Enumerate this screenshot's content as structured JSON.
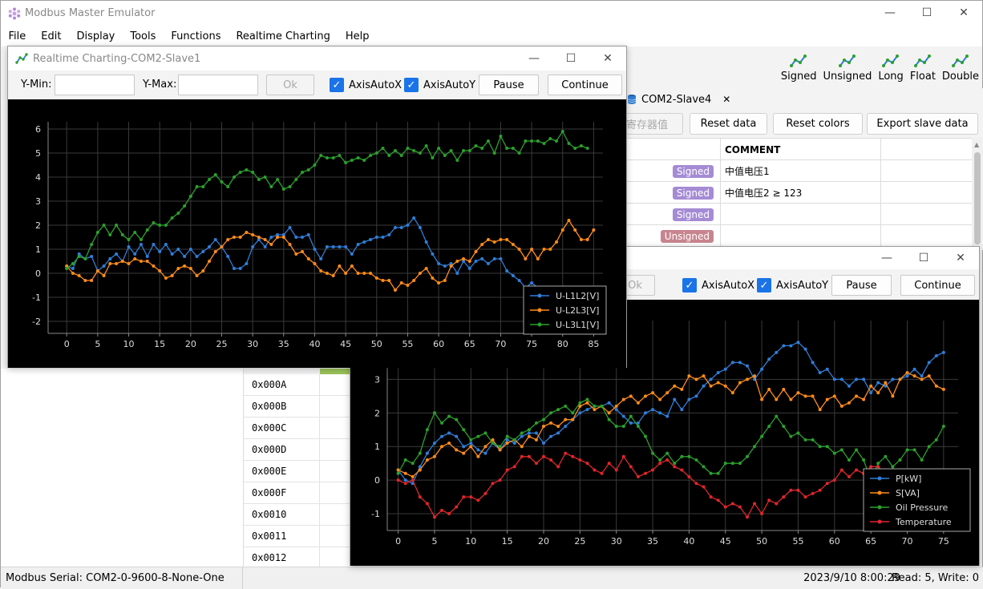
{
  "app": {
    "title": "Modbus Master Emulator",
    "menu": [
      "File",
      "Edit",
      "Display",
      "Tools",
      "Functions",
      "Realtime Charting",
      "Help"
    ],
    "win_buttons": {
      "minimize": "—",
      "maximize": "☐",
      "close": "✕"
    }
  },
  "typebar": {
    "items": [
      "Signed",
      "Unsigned",
      "Long",
      "Float",
      "Double"
    ]
  },
  "tab": {
    "label": "COM2-Slave4",
    "close": "✕"
  },
  "actions": {
    "read_registers": "寄存器值",
    "reset_data": "Reset data",
    "reset_colors": "Reset colors",
    "export": "Export slave data"
  },
  "grid": {
    "header": "COMMENT",
    "rows": [
      {
        "type": "Signed",
        "comment": "中值电压1"
      },
      {
        "type": "Signed",
        "comment": "中值电压2 ≥ 123"
      },
      {
        "type": "Signed",
        "comment": ""
      },
      {
        "type": "Unsigned",
        "comment": ""
      }
    ]
  },
  "addresses": [
    "0x000A",
    "0x000B",
    "0x000C",
    "0x000D",
    "0x000E",
    "0x000F",
    "0x0010",
    "0x0011",
    "0x0012"
  ],
  "status": {
    "left": "Modbus Serial: COM2-0-9600-8-None-One",
    "time": "2023/9/10 8:00:29",
    "counts": "Read: 5, Write: 0"
  },
  "colors": {
    "blue": "#2f7ed8",
    "orange": "#ff8c1a",
    "green": "#2ca02c",
    "red": "#e0262b",
    "badge_signed": "#a58bd4",
    "badge_unsigned": "#c8858f"
  },
  "chart1": {
    "title": "Realtime Charting-COM2-Slave1",
    "ymin_label": "Y-Min:",
    "ymax_label": "Y-Max:",
    "ok": "Ok",
    "auto_x": "AxisAutoX",
    "auto_y": "AxisAutoY",
    "pause": "Pause",
    "continue": "Continue"
  },
  "chart2": {
    "ok": "Ok",
    "auto_x": "AxisAutoX",
    "auto_y": "AxisAutoY",
    "pause": "Pause",
    "continue": "Continue"
  },
  "chart_data": [
    {
      "type": "line",
      "xlim": [
        0,
        86
      ],
      "ylim": [
        -2,
        6
      ],
      "x_ticks": [
        0,
        5,
        10,
        15,
        20,
        25,
        30,
        35,
        40,
        45,
        50,
        55,
        60,
        65,
        70,
        75,
        80,
        85
      ],
      "y_ticks": [
        -2,
        -1,
        0,
        1,
        2,
        3,
        4,
        5,
        6
      ],
      "grid": true,
      "legend": "bottom-right",
      "series": [
        {
          "name": "U-L1L2[V]",
          "color": "#2f7ed8",
          "values": [
            0.3,
            0.2,
            0.8,
            0.6,
            0.7,
            0.1,
            0.3,
            0.6,
            0.8,
            0.5,
            1.1,
            0.8,
            1.2,
            0.7,
            1.2,
            0.9,
            1.2,
            0.8,
            1.0,
            0.7,
            1.0,
            0.7,
            0.9,
            1.1,
            1.4,
            1.1,
            0.7,
            0.2,
            0.2,
            0.4,
            1.1,
            1.4,
            1.1,
            1.5,
            1.6,
            1.6,
            1.9,
            1.5,
            1.5,
            1.6,
            1.0,
            0.6,
            1.1,
            1.1,
            1.1,
            1.1,
            0.8,
            1.2,
            1.3,
            1.4,
            1.5,
            1.5,
            1.6,
            1.9,
            1.9,
            2.0,
            2.3,
            1.9,
            1.3,
            0.8,
            0.4,
            0.3,
            0.4,
            0.0,
            0.5,
            0.2,
            0.5,
            0.6,
            0.4,
            0.6,
            0.6,
            0.1,
            -0.1,
            -0.3,
            -0.6,
            -0.4,
            -0.6,
            -0.6
          ]
        },
        {
          "name": "U-L2L3[V]",
          "color": "#ff8c1a",
          "values": [
            0.3,
            0.0,
            -0.1,
            -0.3,
            -0.3,
            0.1,
            -0.1,
            0.4,
            0.4,
            0.5,
            0.4,
            0.6,
            0.5,
            0.5,
            0.3,
            0.1,
            -0.2,
            -0.1,
            0.2,
            0.3,
            0.2,
            -0.1,
            0.1,
            0.5,
            0.9,
            1.1,
            1.4,
            1.5,
            1.5,
            1.7,
            1.6,
            1.5,
            1.4,
            1.2,
            1.5,
            1.5,
            1.2,
            0.8,
            0.9,
            0.6,
            0.4,
            0.1,
            0.0,
            -0.1,
            0.3,
            0.0,
            0.3,
            0.0,
            0.0,
            0.0,
            -0.2,
            -0.3,
            -0.3,
            -0.7,
            -0.4,
            -0.5,
            -0.3,
            0.0,
            0.2,
            -0.2,
            -0.4,
            -0.3,
            0.3,
            0.5,
            0.6,
            0.5,
            0.9,
            1.2,
            1.4,
            1.3,
            1.4,
            1.4,
            1.2,
            1.0,
            0.6,
            1.0,
            0.6,
            1.0,
            1.0,
            1.3,
            1.8,
            2.2,
            1.8,
            1.4,
            1.4,
            1.8
          ]
        },
        {
          "name": "U-L3L1[V]",
          "color": "#2ca02c",
          "values": [
            0.2,
            0.4,
            0.7,
            0.6,
            1.2,
            1.7,
            2.0,
            1.6,
            2.0,
            1.6,
            1.4,
            1.7,
            1.4,
            1.8,
            2.1,
            2.0,
            2.0,
            2.3,
            2.5,
            2.8,
            3.2,
            3.6,
            3.6,
            3.9,
            4.1,
            3.8,
            3.6,
            4.0,
            4.2,
            4.3,
            4.2,
            3.9,
            4.0,
            3.6,
            3.9,
            3.5,
            3.6,
            3.9,
            4.2,
            4.3,
            4.5,
            4.9,
            4.8,
            4.8,
            4.9,
            4.6,
            4.7,
            4.8,
            4.7,
            4.9,
            5.0,
            5.2,
            4.9,
            5.1,
            4.9,
            5.2,
            5.1,
            5.0,
            5.3,
            4.8,
            5.2,
            4.9,
            5.1,
            4.7,
            5.1,
            5.1,
            5.3,
            5.2,
            5.5,
            5.0,
            5.7,
            5.2,
            5.2,
            5.0,
            5.5,
            5.5,
            5.5,
            5.4,
            5.6,
            5.5,
            5.9,
            5.4,
            5.2,
            5.3,
            5.2
          ]
        }
      ]
    },
    {
      "type": "line",
      "xlim": [
        0,
        75
      ],
      "y_ticks": [
        -1,
        0,
        1,
        2,
        3
      ],
      "x_ticks": [
        0,
        5,
        10,
        15,
        20,
        25,
        30,
        35,
        40,
        45,
        50,
        55,
        60,
        65,
        70,
        75
      ],
      "grid": true,
      "legend": "bottom-right",
      "series": [
        {
          "name": "P[kW]",
          "color": "#2f7ed8",
          "values": [
            0.3,
            0.0,
            -0.1,
            0.4,
            0.8,
            1.1,
            1.3,
            1.4,
            1.3,
            1.0,
            1.1,
            0.9,
            0.8,
            1.1,
            0.9,
            1.2,
            1.1,
            1.3,
            1.4,
            1.4,
            1.1,
            1.3,
            1.4,
            1.6,
            1.8,
            2.0,
            2.1,
            2.2,
            2.2,
            2.3,
            2.1,
            1.9,
            1.7,
            1.7,
            2.0,
            2.1,
            2.0,
            1.9,
            2.4,
            2.1,
            2.4,
            2.5,
            2.8,
            3.0,
            3.2,
            3.3,
            3.5,
            3.5,
            3.4,
            3.0,
            3.3,
            3.6,
            3.8,
            4.0,
            4.0,
            4.1,
            3.9,
            3.5,
            3.2,
            3.3,
            3.0,
            3.0,
            2.8,
            3.0,
            3.0,
            2.6,
            2.9,
            2.8,
            3.0,
            3.0,
            3.1,
            3.3,
            3.1,
            3.5,
            3.7,
            3.8
          ]
        },
        {
          "name": "S[VA]",
          "color": "#ff8c1a",
          "values": [
            0.3,
            0.2,
            0.1,
            0.3,
            0.6,
            0.7,
            1.0,
            1.1,
            0.9,
            0.8,
            1.0,
            0.7,
            1.0,
            1.2,
            0.9,
            1.1,
            1.2,
            1.0,
            1.3,
            1.2,
            1.6,
            1.7,
            1.6,
            1.8,
            1.8,
            2.2,
            2.3,
            2.1,
            2.2,
            2.0,
            2.2,
            2.4,
            2.5,
            2.3,
            2.5,
            2.6,
            2.4,
            2.6,
            2.8,
            2.7,
            3.1,
            3.0,
            3.1,
            2.8,
            2.9,
            2.8,
            2.6,
            2.9,
            3.0,
            3.1,
            2.4,
            2.7,
            2.4,
            2.7,
            2.4,
            2.6,
            2.5,
            2.5,
            2.1,
            2.4,
            2.5,
            2.2,
            2.3,
            2.5,
            2.4,
            2.8,
            2.6,
            2.9,
            2.5,
            3.0,
            3.2,
            3.1,
            3.0,
            3.1,
            2.8,
            2.7
          ]
        },
        {
          "name": "Oil Pressure",
          "color": "#2ca02c",
          "values": [
            0.2,
            0.6,
            0.5,
            0.8,
            1.5,
            2.0,
            1.7,
            1.9,
            1.8,
            1.5,
            1.2,
            1.3,
            1.4,
            1.1,
            1.0,
            1.3,
            1.2,
            1.4,
            1.5,
            1.7,
            1.8,
            2.0,
            2.1,
            2.2,
            2.0,
            2.3,
            2.4,
            2.2,
            2.2,
            1.8,
            1.6,
            1.6,
            1.9,
            1.6,
            1.3,
            0.8,
            0.6,
            0.8,
            0.5,
            0.7,
            0.7,
            0.6,
            0.4,
            0.2,
            0.2,
            0.5,
            0.5,
            0.5,
            0.7,
            1.0,
            1.3,
            1.6,
            1.9,
            1.6,
            1.3,
            1.4,
            1.2,
            1.2,
            1.0,
            1.0,
            0.8,
            0.9,
            0.6,
            0.9,
            0.6,
            0.0,
            0.5,
            0.7,
            0.4,
            0.6,
            0.9,
            0.9,
            0.6,
            1.0,
            1.2,
            1.6
          ]
        },
        {
          "name": "Temperature",
          "color": "#e0262b",
          "values": [
            0.0,
            -0.1,
            0.0,
            -0.5,
            -0.7,
            -1.1,
            -0.9,
            -1.0,
            -0.8,
            -0.5,
            -0.5,
            -0.6,
            -0.4,
            -0.1,
            0.0,
            0.3,
            0.4,
            0.7,
            0.7,
            0.5,
            0.7,
            0.6,
            0.4,
            0.8,
            0.7,
            0.6,
            0.5,
            0.3,
            0.2,
            0.5,
            0.3,
            0.7,
            0.4,
            0.1,
            0.2,
            0.3,
            0.5,
            0.6,
            0.4,
            0.3,
            0.1,
            -0.1,
            -0.2,
            -0.5,
            -0.6,
            -0.8,
            -0.7,
            -0.8,
            -1.1,
            -0.7,
            -1.0,
            -0.6,
            -0.7,
            -0.5,
            -0.3,
            -0.3,
            -0.5,
            -0.4,
            -0.3,
            -0.1,
            0.0,
            0.3,
            0.1,
            0.3,
            0.2,
            0.4,
            0.4,
            0.2,
            -0.3,
            -0.2,
            -0.6,
            -0.4,
            -0.3,
            -0.4,
            -0.5,
            -0.6
          ]
        }
      ]
    }
  ]
}
